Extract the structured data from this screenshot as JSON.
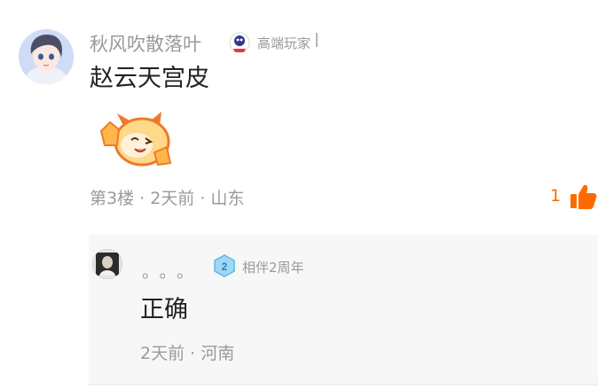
{
  "comment": {
    "username": "秋风吹散落叶",
    "badge_label": "高端玩家",
    "badge_icon": "player-badge-icon",
    "text": "赵云天宫皮",
    "sticker_icon": "thumbs-up-sticker-icon",
    "meta": "第3楼 · 2天前 · 山东",
    "like_count": "1",
    "like_color": "#ff6a00"
  },
  "reply": {
    "username": "。。。",
    "badge_number": "2",
    "badge_label": "相伴2周年",
    "text": "正确",
    "meta": "2天前 · 河南"
  }
}
